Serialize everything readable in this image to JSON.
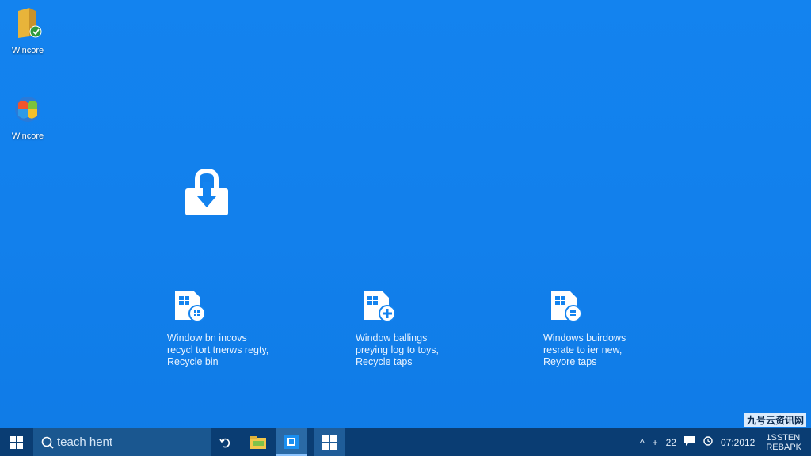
{
  "desktop": {
    "icons": [
      {
        "label": "Wincore",
        "icon": "folder-icon"
      },
      {
        "label": "Wincore",
        "icon": "windows-logo-icon"
      }
    ],
    "center_icon": "lock-download-icon",
    "tiles": [
      {
        "icon": "document-windows-icon",
        "lines": [
          "Window bn incovs",
          "recycl tort tnerws regty,",
          "Recycle bin"
        ]
      },
      {
        "icon": "document-add-icon",
        "lines": [
          "Window ballings",
          "preying log to toys,",
          "Recycle taps"
        ]
      },
      {
        "icon": "document-windows-icon",
        "lines": [
          "Windows buirdows",
          "resrate to ier new,",
          "Reyore taps"
        ]
      }
    ]
  },
  "taskbar": {
    "search_placeholder": "teach hent",
    "tray": {
      "caret": "^",
      "plus": "+",
      "count": "22",
      "time": "07:2012",
      "clock_line1": "1SSTEN",
      "clock_line2": "REBAPK"
    }
  },
  "watermark": "九号云资讯网"
}
